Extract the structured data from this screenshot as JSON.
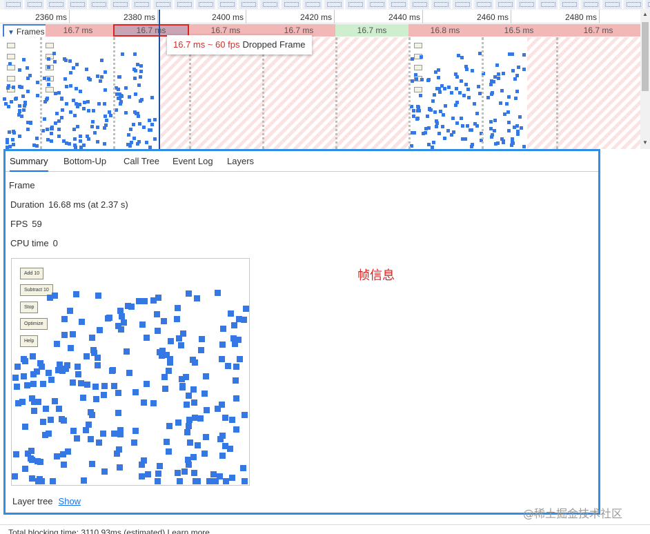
{
  "ruler": {
    "ticks": [
      "2360 ms",
      "2380 ms",
      "2400 ms",
      "2420 ms",
      "2440 ms",
      "2460 ms",
      "2480 ms"
    ]
  },
  "frames_row": {
    "label": "Frames",
    "frames": [
      {
        "text": "16.7 ms",
        "status": "dropped"
      },
      {
        "text": "16.7 ms",
        "status": "selected"
      },
      {
        "text": "16.7 ms",
        "status": "dropped"
      },
      {
        "text": "16.7 ms",
        "status": "dropped"
      },
      {
        "text": "16.7 ms",
        "status": "good"
      },
      {
        "text": "16.8 ms",
        "status": "dropped"
      },
      {
        "text": "16.5 ms",
        "status": "dropped"
      },
      {
        "text": "16.7 ms",
        "status": "dropped"
      }
    ]
  },
  "tooltip": {
    "fps": "16.7 ms ~ 60 fps",
    "label": "Dropped Frame"
  },
  "tabs": [
    "Summary",
    "Bottom-Up",
    "Call Tree",
    "Event Log",
    "Layers"
  ],
  "summary": {
    "heading": "Frame",
    "duration_label": "Duration",
    "duration_value": "16.68 ms (at 2.37 s)",
    "fps_label": "FPS",
    "fps_value": "59",
    "cpu_label": "CPU time",
    "cpu_value": "0",
    "preview_buttons": [
      "Add 10",
      "Subtract 10",
      "Stop",
      "Optimize",
      "Help"
    ],
    "layer_tree_label": "Layer tree",
    "layer_tree_link": "Show"
  },
  "annotation": "帧信息",
  "footer": "Total blocking time: 3110.93ms (estimated)  Learn more",
  "watermark": "@稀土掘金技术社区",
  "colors": {
    "accent": "#2f8de4",
    "dropped_frame": "#f2b7b7",
    "good_frame": "#cfeecf",
    "link": "#1a73e8",
    "annotation": "#e02020",
    "square": "#3577e3"
  }
}
